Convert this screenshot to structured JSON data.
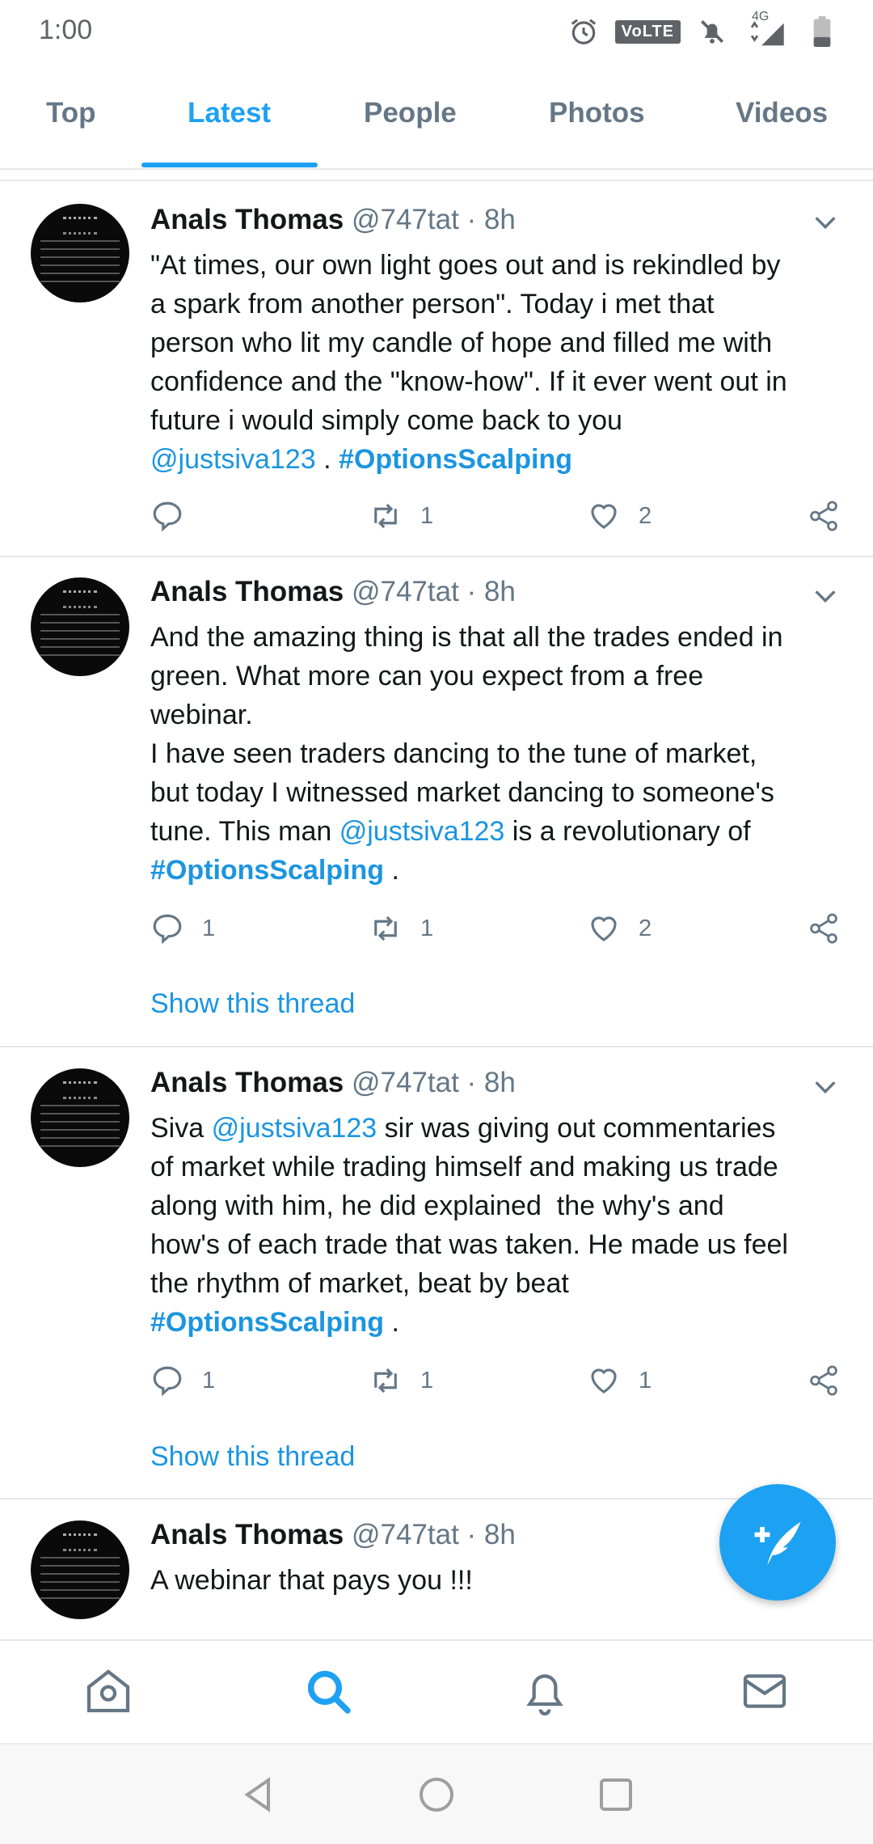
{
  "status_bar": {
    "time": "1:00",
    "volte": "VoLTE",
    "network": "4G"
  },
  "tabs": [
    {
      "label": "Top"
    },
    {
      "label": "Latest"
    },
    {
      "label": "People"
    },
    {
      "label": "Photos"
    },
    {
      "label": "Videos"
    }
  ],
  "tweets": [
    {
      "author": "Anals Thomas",
      "handle": "@747tat",
      "time": "· 8h",
      "text_lines": [
        "\"At times, our own light goes out and is rekindled by",
        "a spark from another person\". Today i met that",
        "person who lit my candle of hope and filled me with",
        "confidence and the \"know-how\". If it ever went out in",
        "future i would simply come back to you"
      ],
      "mention": "@justsiva123",
      "sep": " . ",
      "hashtag": "#OptionsScalping",
      "replies": "",
      "retweets": "1",
      "likes": "2"
    },
    {
      "author": "Anals Thomas",
      "handle": "@747tat",
      "time": "· 8h",
      "text_lines": [
        "And the amazing thing is that all the trades ended in",
        "green. What more can you expect from a free",
        "webinar.",
        "I have seen traders dancing to the tune of market,",
        "but today I witnessed market dancing to someone's"
      ],
      "line6_pre": "tune. This man ",
      "mention": "@justsiva123",
      "line6_post": " is a revolutionary of",
      "hashtag": "#OptionsScalping",
      "tail": " .",
      "replies": "1",
      "retweets": "1",
      "likes": "2",
      "show_thread": "Show this thread"
    },
    {
      "author": "Anals Thomas",
      "handle": "@747tat",
      "time": "· 8h",
      "line1_pre": "Siva ",
      "mention": "@justsiva123",
      "line1_post": " sir was giving out commentaries",
      "text_lines": [
        "of market while trading himself and making us trade",
        "along with him, he did explained  the why's and",
        "how's of each trade that was taken. He made us feel",
        "the rhythm of market, beat by beat"
      ],
      "hashtag": "#OptionsScalping",
      "tail": " .",
      "replies": "1",
      "retweets": "1",
      "likes": "1",
      "show_thread": "Show this thread"
    },
    {
      "author": "Anals Thomas",
      "handle": "@747tat",
      "time": "· 8h",
      "text": "A webinar that pays you !!!"
    }
  ],
  "colors": {
    "accent": "#1da1f2",
    "secondary_text": "#657786",
    "primary_text": "#14171a"
  },
  "icons": {
    "compose": "compose-tweet-icon",
    "home": "home-icon",
    "search": "search-icon",
    "notifications": "bell-icon",
    "messages": "mail-icon"
  }
}
